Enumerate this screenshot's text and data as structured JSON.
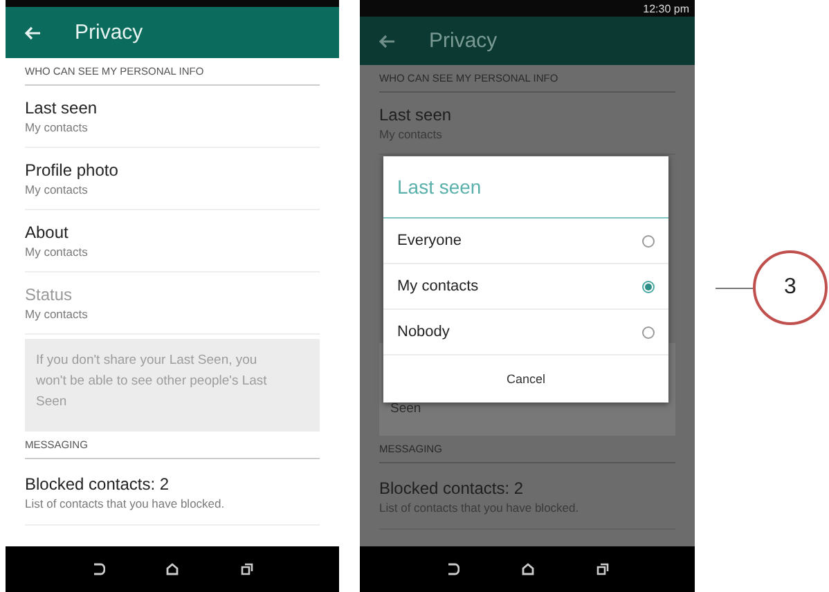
{
  "left_phone": {
    "title": "Privacy",
    "sections": [
      {
        "header": "WHO CAN SEE MY PERSONAL INFO",
        "rows": [
          {
            "title": "Last seen",
            "subtitle": "My contacts",
            "disabled": false
          },
          {
            "title": "Profile photo",
            "subtitle": "My contacts",
            "disabled": false
          },
          {
            "title": "About",
            "subtitle": "My contacts",
            "disabled": false
          },
          {
            "title": "Status",
            "subtitle": "My contacts",
            "disabled": true
          }
        ],
        "note": "If you don't share your Last Seen, you won't be able to see other people's Last Seen"
      },
      {
        "header": "MESSAGING",
        "rows": [
          {
            "title": "Blocked contacts: 2",
            "subtitle": "List of contacts that you have blocked.",
            "disabled": false
          }
        ]
      }
    ]
  },
  "right_phone": {
    "status_time": "12:30 pm",
    "title": "Privacy",
    "section_header": "WHO CAN SEE MY PERSONAL INFO",
    "row": {
      "title": "Last seen",
      "subtitle": "My contacts"
    },
    "note_fragment": "Seen",
    "section_header_2": "MESSAGING",
    "row_2": {
      "title": "Blocked contacts: 2",
      "subtitle": "List of contacts that you have blocked."
    },
    "dialog": {
      "title": "Last seen",
      "options": [
        {
          "label": "Everyone",
          "selected": false
        },
        {
          "label": "My contacts",
          "selected": true
        },
        {
          "label": "Nobody",
          "selected": false
        }
      ],
      "cancel": "Cancel"
    }
  },
  "callout": {
    "label": "3"
  }
}
